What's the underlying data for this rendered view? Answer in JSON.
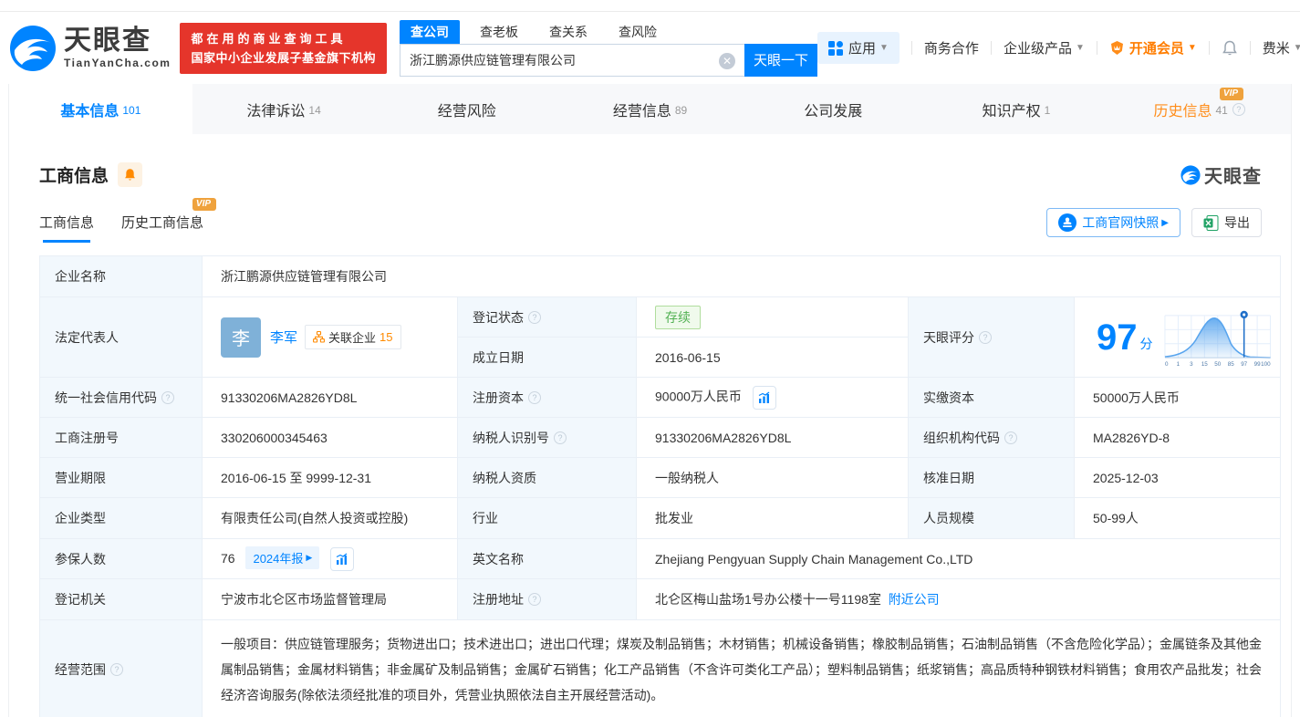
{
  "header": {
    "logo": {
      "name": "天眼查",
      "domain": "TianYanCha.com"
    },
    "promo": {
      "line1": "都在用的商业查询工具",
      "line2": "国家中小企业发展子基金旗下机构"
    },
    "search": {
      "tab_company": "查公司",
      "tab_boss": "查老板",
      "tab_relation": "查关系",
      "tab_risk": "查风险",
      "value": "浙江鹏源供应链管理有限公司",
      "clear": "✕",
      "button": "天眼一下"
    },
    "menu": {
      "apps": "应用",
      "cooperation": "商务合作",
      "enterprise": "企业级产品",
      "vip": "开通会员",
      "user": "费米"
    }
  },
  "nav": {
    "tabs": [
      {
        "label": "基本信息",
        "count": "101"
      },
      {
        "label": "法律诉讼",
        "count": "14"
      },
      {
        "label": "经营风险",
        "count": ""
      },
      {
        "label": "经营信息",
        "count": "89"
      },
      {
        "label": "公司发展",
        "count": ""
      },
      {
        "label": "知识产权",
        "count": "1"
      },
      {
        "label": "历史信息",
        "count": "41"
      }
    ],
    "vip_badge": "VIP"
  },
  "section": {
    "title": "工商信息",
    "logo": "天眼查",
    "subtab_current": "工商信息",
    "subtab_history": "历史工商信息",
    "vip_badge": "VIP",
    "snapshot_button": "工商官网快照",
    "export_button": "导出"
  },
  "info": {
    "company_name": {
      "label": "企业名称",
      "value": "浙江鹏源供应链管理有限公司"
    },
    "legal_rep": {
      "label": "法定代表人",
      "avatar": "李",
      "name": "李军",
      "related_label": "关联企业",
      "related_count": "15"
    },
    "reg_status": {
      "label": "登记状态",
      "value": "存续"
    },
    "establish_date": {
      "label": "成立日期",
      "value": "2016-06-15"
    },
    "score": {
      "label": "天眼评分",
      "value": "97",
      "unit": "分",
      "axis": [
        "0",
        "1",
        "3",
        "15",
        "50",
        "85",
        "97",
        "99",
        "100"
      ]
    },
    "credit_code": {
      "label": "统一社会信用代码",
      "value": "91330206MA2826YD8L"
    },
    "reg_capital": {
      "label": "注册资本",
      "value": "90000万人民币"
    },
    "paid_capital": {
      "label": "实缴资本",
      "value": "50000万人民币"
    },
    "reg_number": {
      "label": "工商注册号",
      "value": "330206000345463"
    },
    "taxpayer_id": {
      "label": "纳税人识别号",
      "value": "91330206MA2826YD8L"
    },
    "org_code": {
      "label": "组织机构代码",
      "value": "MA2826YD-8"
    },
    "business_term": {
      "label": "营业期限",
      "value": "2016-06-15 至 9999-12-31"
    },
    "taxpayer_quality": {
      "label": "纳税人资质",
      "value": "一般纳税人"
    },
    "approval_date": {
      "label": "核准日期",
      "value": "2025-12-03"
    },
    "company_type": {
      "label": "企业类型",
      "value": "有限责任公司(自然人投资或控股)"
    },
    "industry": {
      "label": "行业",
      "value": "批发业"
    },
    "staff_size": {
      "label": "人员规模",
      "value": "50-99人"
    },
    "insured": {
      "label": "参保人数",
      "value": "76",
      "report_badge": "2024年报"
    },
    "english_name": {
      "label": "英文名称",
      "value": "Zhejiang Pengyuan Supply Chain Management Co.,LTD"
    },
    "reg_authority": {
      "label": "登记机关",
      "value": "宁波市北仑区市场监督管理局"
    },
    "address": {
      "label": "注册地址",
      "value": "北仑区梅山盐场1号办公楼十一号1198室",
      "nearby_link": "附近公司"
    },
    "business_scope": {
      "label": "经营范围",
      "value": "一般项目：供应链管理服务；货物进出口；技术进出口；进出口代理；煤炭及制品销售；木材销售；机械设备销售；橡胶制品销售；石油制品销售（不含危险化学品）；金属链条及其他金属制品销售；金属材料销售；非金属矿及制品销售；金属矿石销售；化工产品销售（不含许可类化工产品）；塑料制品销售；纸浆销售；高品质特种钢铁材料销售；食用农产品批发；社会经济咨询服务(除依法须经批准的项目外，凭营业执照依法自主开展经营活动)。"
    }
  },
  "colors": {
    "accent_blue": "#0084ff",
    "promo_red": "#e5352b",
    "vip_orange": "#ff8d1a",
    "status_green": "#52b153"
  }
}
